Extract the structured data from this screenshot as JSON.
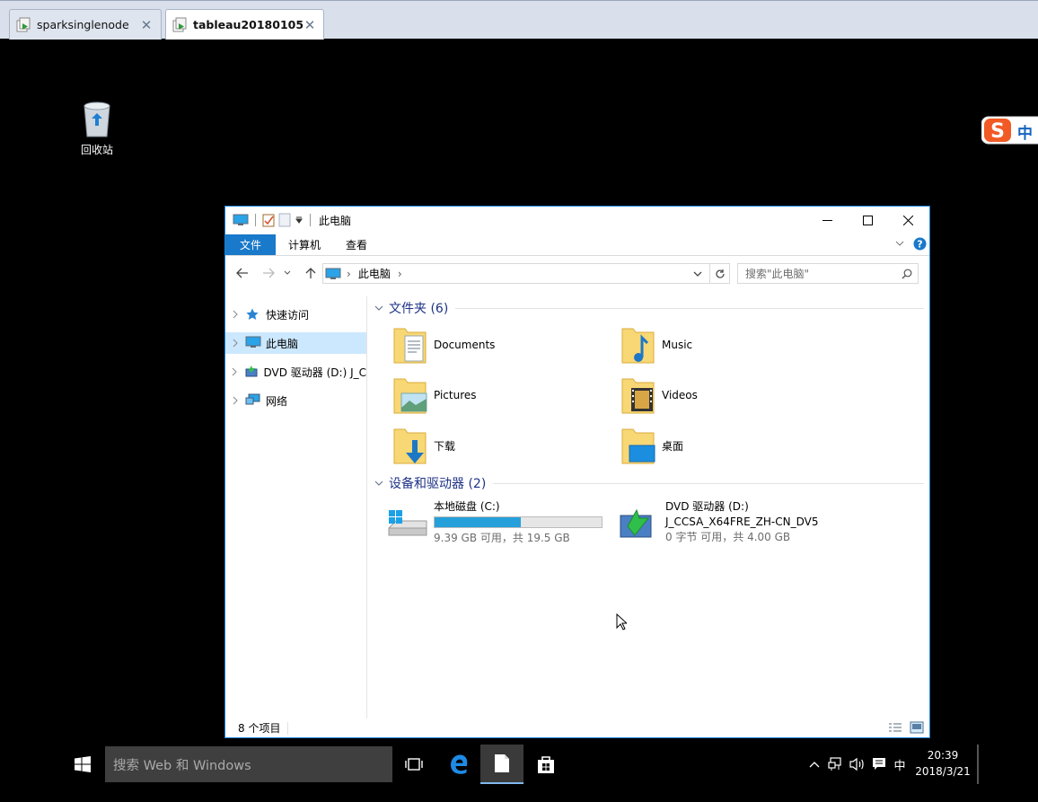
{
  "vm_tabs": [
    {
      "label": "sparksinglenode",
      "close": "✕",
      "active": false
    },
    {
      "label": "tableau20180105",
      "close": "✕",
      "active": true
    }
  ],
  "desktop": {
    "recycle_bin_label": "回收站",
    "ime_badge_text": "中"
  },
  "explorer": {
    "title": "此电脑",
    "ribbon_tabs": [
      "文件",
      "计算机",
      "查看"
    ],
    "address": {
      "segment": "此电脑",
      "separator": "›"
    },
    "search_placeholder": "搜索\"此电脑\"",
    "nav_items": [
      {
        "label": "快速访问",
        "icon": "star-icon"
      },
      {
        "label": "此电脑",
        "icon": "computer-icon",
        "selected": true
      },
      {
        "label": "DVD 驱动器 (D:) J_C",
        "icon": "dvd-drive-icon"
      },
      {
        "label": "网络",
        "icon": "network-icon"
      }
    ],
    "folders_header": "文件夹 (6)",
    "folders": [
      {
        "label": "Documents",
        "icon": "documents-folder-icon"
      },
      {
        "label": "Music",
        "icon": "music-folder-icon"
      },
      {
        "label": "Pictures",
        "icon": "pictures-folder-icon"
      },
      {
        "label": "Videos",
        "icon": "videos-folder-icon"
      },
      {
        "label": "下载",
        "icon": "downloads-folder-icon"
      },
      {
        "label": "桌面",
        "icon": "desktop-folder-icon"
      }
    ],
    "drives_header": "设备和驱动器 (2)",
    "drives": [
      {
        "name": "本地磁盘 (C:)",
        "used_fraction": 0.518,
        "space": "9.39 GB 可用，共 19.5 GB",
        "icon": "local-disk-icon"
      },
      {
        "name": "DVD 驱动器 (D:)",
        "volume": "J_CCSA_X64FRE_ZH-CN_DV5",
        "space": "0 字节 可用，共 4.00 GB",
        "icon": "dvd-drive-icon"
      }
    ],
    "status": "8 个项目"
  },
  "taskbar": {
    "search_placeholder": "搜索 Web 和 Windows",
    "ime_indicator": "中",
    "time": "20:39",
    "date": "2018/3/21"
  },
  "colors": {
    "accent": "#1979ca",
    "selection": "#cce8ff",
    "group_header": "#1e3287",
    "drive_bar": "#26a0da"
  }
}
